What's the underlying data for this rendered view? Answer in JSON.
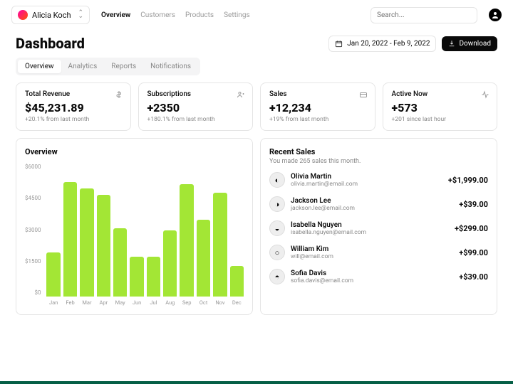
{
  "team": {
    "name": "Alicia Koch"
  },
  "nav": {
    "overview": "Overview",
    "customers": "Customers",
    "products": "Products",
    "settings": "Settings"
  },
  "search": {
    "placeholder": "Search..."
  },
  "page_title": "Dashboard",
  "date_range": "Jan 20, 2022 - Feb 9, 2022",
  "download_label": "Download",
  "tabs": {
    "overview": "Overview",
    "analytics": "Analytics",
    "reports": "Reports",
    "notifications": "Notifications"
  },
  "stats": [
    {
      "label": "Total Revenue",
      "value": "$45,231.89",
      "sub": "+20.1% from last month"
    },
    {
      "label": "Subscriptions",
      "value": "+2350",
      "sub": "+180.1% from last month"
    },
    {
      "label": "Sales",
      "value": "+12,234",
      "sub": "+19% from last month"
    },
    {
      "label": "Active Now",
      "value": "+573",
      "sub": "+201 since last hour"
    }
  ],
  "overview_title": "Overview",
  "recent": {
    "title": "Recent Sales",
    "subtitle": "You made 265 sales this month.",
    "items": [
      {
        "name": "Olivia Martin",
        "email": "olivia.martin@email.com",
        "amount": "+$1,999.00"
      },
      {
        "name": "Jackson Lee",
        "email": "jackson.lee@email.com",
        "amount": "+$39.00"
      },
      {
        "name": "Isabella Nguyen",
        "email": "isabella.nguyen@email.com",
        "amount": "+$299.00"
      },
      {
        "name": "William Kim",
        "email": "will@email.com",
        "amount": "+$99.00"
      },
      {
        "name": "Sofia Davis",
        "email": "sofia.davis@email.com",
        "amount": "+$39.00"
      }
    ]
  },
  "chart_data": {
    "type": "bar",
    "categories": [
      "Jan",
      "Feb",
      "Mar",
      "Apr",
      "May",
      "Jun",
      "Jul",
      "Aug",
      "Sep",
      "Oct",
      "Nov",
      "Dec"
    ],
    "values": [
      2000,
      5200,
      4900,
      4600,
      3100,
      1800,
      1800,
      3000,
      5100,
      3500,
      4700,
      1400
    ],
    "ylabels": [
      "$6000",
      "$4500",
      "$3000",
      "$1500",
      "$0"
    ],
    "ymax": 6000,
    "xlabel": "",
    "ylabel": "",
    "title": ""
  }
}
